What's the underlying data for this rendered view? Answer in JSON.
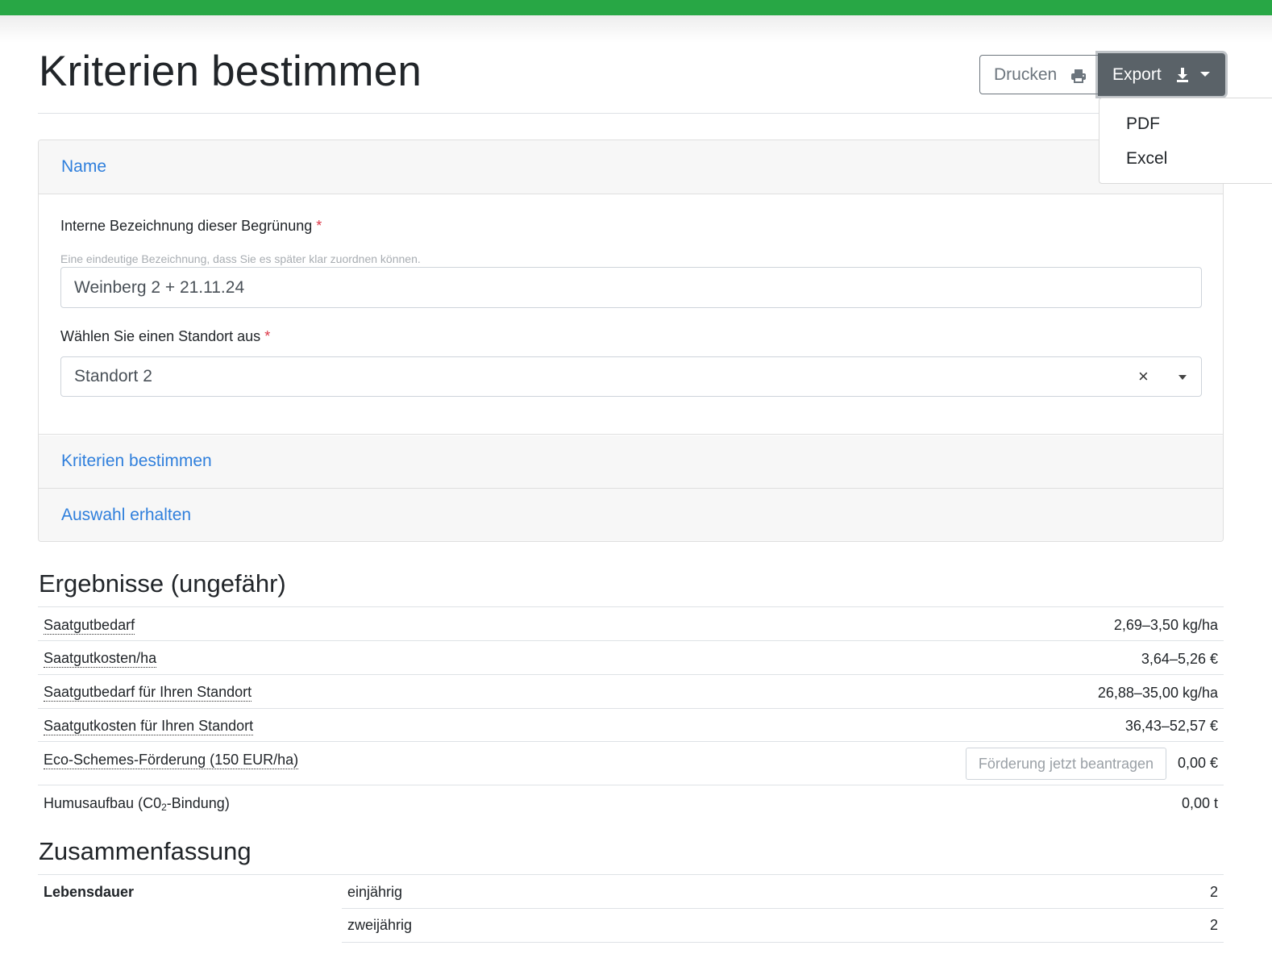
{
  "page": {
    "title": "Kriterien bestimmen"
  },
  "toolbar": {
    "print_label": "Drucken",
    "export_label": "Export"
  },
  "export_menu": {
    "items": [
      "PDF",
      "Excel"
    ]
  },
  "accordion": {
    "sections": [
      {
        "label": "Name",
        "expanded": true
      },
      {
        "label": "Kriterien bestimmen",
        "expanded": false
      },
      {
        "label": "Auswahl erhalten",
        "expanded": false
      }
    ],
    "name_field": {
      "label": "Interne Bezeichnung dieser Begrünung",
      "required_mark": "*",
      "help": "Eine eindeutige Bezeichnung, dass Sie es später klar zuordnen können.",
      "value": "Weinberg 2 + 21.11.24"
    },
    "location_field": {
      "label": "Wählen Sie einen Standort aus",
      "required_mark": "*",
      "value": "Standort 2",
      "clear_symbol": "×"
    }
  },
  "results": {
    "title": "Ergebnisse (ungefähr)",
    "rows": [
      {
        "label": "Saatgutbedarf",
        "value": "2,69–3,50 kg/ha"
      },
      {
        "label": "Saatgutkosten/ha",
        "value": "3,64–5,26 €"
      },
      {
        "label": "Saatgutbedarf für Ihren Standort",
        "value": "26,88–35,00 kg/ha"
      },
      {
        "label": "Saatgutkosten für Ihren Standort",
        "value": "36,43–52,57 €"
      },
      {
        "label": "Eco-Schemes-Förderung (150 EUR/ha)",
        "value": "0,00 €",
        "action": "Förderung jetzt beantragen"
      },
      {
        "label_prefix": "Humusaufbau (C0",
        "label_sub": "2",
        "label_suffix": "-Bindung)",
        "value": "0,00 t"
      }
    ]
  },
  "summary": {
    "title": "Zusammenfassung",
    "group": "Lebensdauer",
    "rows": [
      {
        "label": "einjährig",
        "value": "2"
      },
      {
        "label": "zweijährig",
        "value": "2"
      }
    ]
  },
  "colors": {
    "brand": "#28a745",
    "link": "#2f7fdc",
    "required": "#dc3545",
    "export_btn": "#5a6268"
  }
}
